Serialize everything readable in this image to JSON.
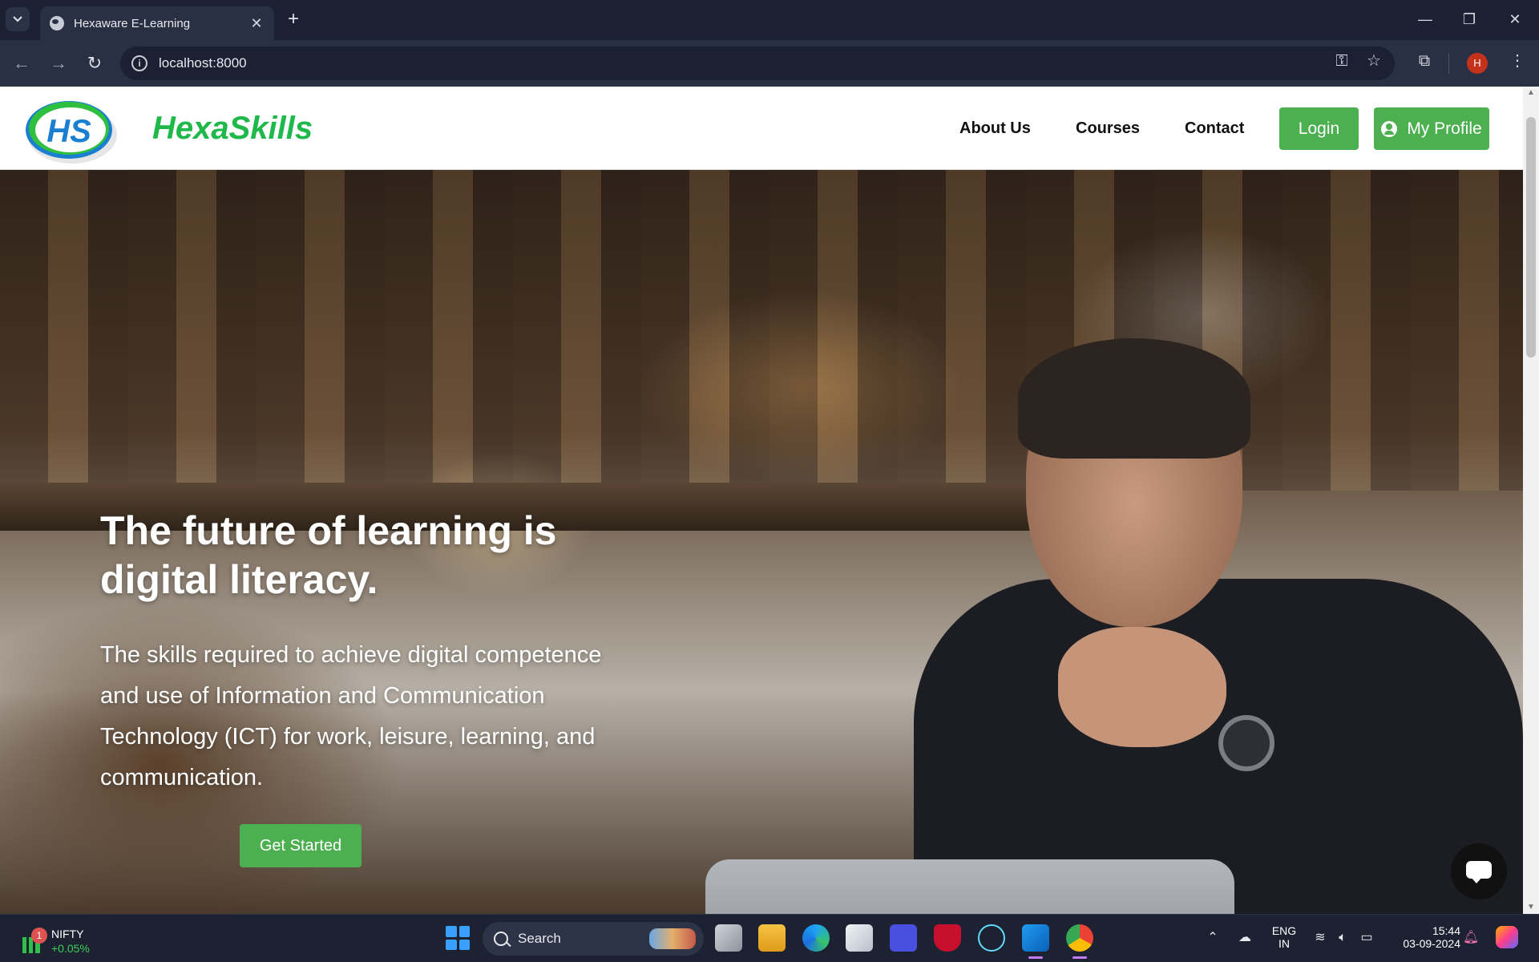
{
  "browser": {
    "tab_title": "Hexaware E-Learning",
    "url": "localhost:8000",
    "profile_initial": "H",
    "tab_close_glyph": "✕",
    "new_tab_glyph": "+",
    "window_controls": [
      "—",
      "❐",
      "✕"
    ]
  },
  "site": {
    "brand": "HexaSkills",
    "logo_text": "HS",
    "nav": [
      "About Us",
      "Courses",
      "Contact"
    ],
    "login_label": "Login",
    "profile_label": "My Profile"
  },
  "hero": {
    "title": "The future of learning is digital literacy.",
    "subtitle": "The skills required to achieve digital competence and use of Information and Communication Technology (ICT) for work, leisure, learning, and communication.",
    "cta_label": "Get Started"
  },
  "taskbar": {
    "widget_badge": "1",
    "widget_name": "NIFTY",
    "widget_change": "+0.05%",
    "search_label": "Search",
    "language_line1": "ENG",
    "language_line2": "IN",
    "time": "15:44",
    "date": "03-09-2024"
  },
  "colors": {
    "accent_green": "#4caf50",
    "brand_green": "#1fb84a",
    "chrome_dark": "#1b2133"
  },
  "icons": [
    "tab-search-icon",
    "globe-favicon-icon",
    "back-arrow-icon",
    "forward-arrow-icon",
    "reload-icon",
    "info-icon",
    "password-key-icon",
    "bookmark-star-icon",
    "extensions-icon",
    "menu-dots-icon",
    "user-icon",
    "chat-bot-icon",
    "windows-start-icon",
    "search-icon"
  ]
}
